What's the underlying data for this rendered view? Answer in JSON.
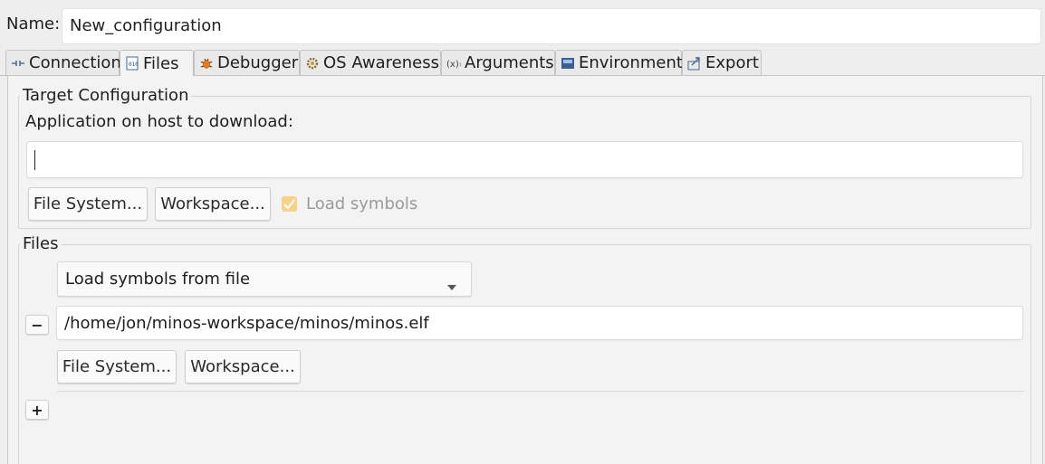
{
  "name_label": "Name:",
  "name_value": "New_configuration",
  "tabs": [
    {
      "label": "Connection",
      "icon": "connection-icon"
    },
    {
      "label": "Files",
      "icon": "files-icon",
      "active": true
    },
    {
      "label": "Debugger",
      "icon": "debugger-bug-icon"
    },
    {
      "label": "OS Awareness",
      "icon": "os-gear-icon"
    },
    {
      "label": "Arguments",
      "icon": "arguments-icon"
    },
    {
      "label": "Environment",
      "icon": "environment-icon"
    },
    {
      "label": "Export",
      "icon": "export-icon"
    }
  ],
  "target": {
    "group_title": "Target Configuration",
    "app_label": "Application on host to download:",
    "app_value": "",
    "file_system_btn": "File System...",
    "workspace_btn": "Workspace...",
    "load_symbols_label": "Load symbols",
    "load_symbols_checked": true
  },
  "files": {
    "group_title": "Files",
    "mode_selected": "Load symbols from file",
    "remove_btn": "−",
    "path_value": "/home/jon/minos-workspace/minos/minos.elf",
    "file_system_btn": "File System...",
    "workspace_btn": "Workspace...",
    "add_btn": "+"
  },
  "colors": {
    "checkbox_fill": "#f7d38a",
    "background": "#eeeeee"
  }
}
